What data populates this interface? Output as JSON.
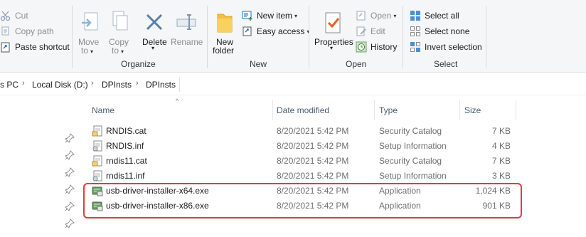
{
  "ribbon": {
    "clipboard": {
      "cut": "Cut",
      "copy_path": "Copy path",
      "paste_shortcut": "Paste shortcut"
    },
    "organize": {
      "label": "Organize",
      "move_to": [
        "Move",
        "to"
      ],
      "copy_to": [
        "Copy",
        "to"
      ],
      "delete": "Delete",
      "rename": "Rename"
    },
    "new": {
      "label": "New",
      "new_folder": [
        "New",
        "folder"
      ],
      "new_item": "New item",
      "easy_access": "Easy access"
    },
    "open": {
      "label": "Open",
      "properties": "Properties",
      "open": "Open",
      "edit": "Edit",
      "history": "History"
    },
    "select": {
      "label": "Select",
      "select_all": "Select all",
      "select_none": "Select none",
      "invert_selection": "Invert selection"
    }
  },
  "breadcrumb": [
    "s PC",
    "Local Disk (D:)",
    "DPInsts",
    "DPInsts"
  ],
  "columns": [
    "Name",
    "Date modified",
    "Type",
    "Size"
  ],
  "files": [
    {
      "name": "RNDIS.cat",
      "date": "8/20/2021 5:42 PM",
      "type": "Security Catalog",
      "size": "7 KB",
      "icon": "catalog-file-icon"
    },
    {
      "name": "RNDIS.inf",
      "date": "8/20/2021 5:42 PM",
      "type": "Setup Information",
      "size": "4 KB",
      "icon": "setup-info-file-icon"
    },
    {
      "name": "rndis11.cat",
      "date": "8/20/2021 5:42 PM",
      "type": "Security Catalog",
      "size": "7 KB",
      "icon": "catalog-file-icon"
    },
    {
      "name": "rndis11.inf",
      "date": "8/20/2021 5:42 PM",
      "type": "Setup Information",
      "size": "3 KB",
      "icon": "setup-info-file-icon"
    },
    {
      "name": "usb-driver-installer-x64.exe",
      "date": "8/20/2021 5:42 PM",
      "type": "Application",
      "size": "1,024 KB",
      "icon": "installer-app-icon"
    },
    {
      "name": "usb-driver-installer-x86.exe",
      "date": "8/20/2021 5:42 PM",
      "type": "Application",
      "size": "901 KB",
      "icon": "installer-app-icon"
    }
  ],
  "colors": {
    "highlight_border": "#e23b3b",
    "ribbon_background": "#f5f6f7",
    "accent_blue": "#1e73c8"
  }
}
